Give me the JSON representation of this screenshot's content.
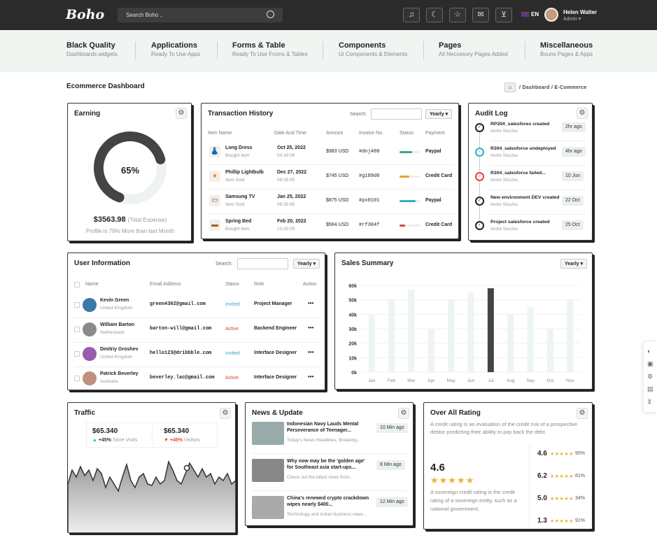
{
  "topbar": {
    "logo": "Boho",
    "search_placeholder": "Search Boho ..",
    "lang": "EN",
    "user_name": "Helen Walter",
    "user_role": "Admin"
  },
  "mega": [
    {
      "title": "Black Quality",
      "sub": "Dashboards,widgets."
    },
    {
      "title": "Applications",
      "sub": "Ready To Use Apps"
    },
    {
      "title": "Forms & Table",
      "sub": "Ready To Use Froms & Tables"
    },
    {
      "title": "Components",
      "sub": "Ui Components & Elements"
    },
    {
      "title": "Pages",
      "sub": "All Neccesory Pages Added"
    },
    {
      "title": "Miscellaneous",
      "sub": "Bouns Pages & Apps"
    }
  ],
  "page": {
    "title": "Ecommerce Dashboard",
    "crumb1": "Dashboard",
    "crumb2": "E-Commerce"
  },
  "earning": {
    "title": "Earning",
    "percent": "65%",
    "percent_value": 65,
    "amount": "$3563.98",
    "amount_note": "(Total Expense)",
    "profile": "Profile is 76% More than last Month"
  },
  "transactions": {
    "title": "Transaction History",
    "search_label": "Search:",
    "filter": "Yearly",
    "headers": [
      "Item Name",
      "Date And Time",
      "Amount",
      "Invoice No.",
      "Status",
      "Payment"
    ],
    "rows": [
      {
        "name": "Long Dress",
        "sub": "Bought item",
        "date": "Oct 25, 2022",
        "time": "04:39:08",
        "amount": "$983 USD",
        "invoice": "#dnj480",
        "status_fill": 0.6,
        "status_color": "#3aa87a",
        "payment": "Paypal"
      },
      {
        "name": "Phillip Lightbulb",
        "sub": "Item Sold",
        "date": "Dec 27, 2022",
        "time": "08:35:65",
        "amount": "$745 USD",
        "invoice": "#g189d0",
        "status_fill": 0.45,
        "status_color": "#f0a030",
        "payment": "Credit Card"
      },
      {
        "name": "Samsung TV",
        "sub": "Item Sold",
        "date": "Jan 25, 2022",
        "time": "08:35:65",
        "amount": "$875 USD",
        "invoice": "#px0101",
        "status_fill": 0.75,
        "status_color": "#2bb3c0",
        "payment": "Paypal"
      },
      {
        "name": "Spring Bed",
        "sub": "Bought item",
        "date": "Feb 20, 2022",
        "time": "12:35:00",
        "amount": "$564 USD",
        "invoice": "#rf304f",
        "status_fill": 0.25,
        "status_color": "#e04040",
        "payment": "Credit Card"
      }
    ]
  },
  "audit": {
    "title": "Audit Log",
    "items": [
      {
        "title": "RP204_salesfores created",
        "by": "Andre Sluczka",
        "when": "2hr ago",
        "color": "#222"
      },
      {
        "title": "R304_salesforce undeployed",
        "by": "Andre Sluczka",
        "when": "4hr ago",
        "color": "#2bb3c0"
      },
      {
        "title": "R304_salesforce failed...",
        "by": "Andre Sluczka",
        "when": "10 Jun",
        "color": "#e04040"
      },
      {
        "title": "New environment DEV created",
        "by": "Andre Sluczka",
        "when": "22 Oct",
        "color": "#222"
      },
      {
        "title": "Project salesforce created",
        "by": "Andre Sluczka",
        "when": "25 Oct",
        "color": "#222"
      }
    ]
  },
  "users": {
    "title": "User Information",
    "search_label": "Search:",
    "filter": "Yearly",
    "headers": [
      "Name",
      "Email Address",
      "Status",
      "Role",
      "Action"
    ],
    "rows": [
      {
        "name": "Kevin Green",
        "country": "United Kingdom",
        "email": "green4302@gmail.com",
        "status": "Invited",
        "status_color": "#3aa8c0",
        "role": "Project Manager",
        "action": "•••",
        "avatar": "#3a7aa8"
      },
      {
        "name": "William Barton",
        "country": "Netherlands",
        "email": "barton-will@gmail.com",
        "status": "Active",
        "status_color": "#e04040",
        "role": "Backend Engineer",
        "action": "•••",
        "avatar": "#8a8a8a"
      },
      {
        "name": "Dmitriy Groshev",
        "country": "United Kingdom",
        "email": "hello123@dribbble.com",
        "status": "Invited",
        "status_color": "#3aa8c0",
        "role": "Interface Designer",
        "action": "•••",
        "avatar": "#9a5ab0"
      },
      {
        "name": "Patrick Beverley",
        "country": "Australia",
        "email": "beverley.lac@gmail.com",
        "status": "Active",
        "status_color": "#e04040",
        "role": "Interface Designer",
        "action": "•••",
        "avatar": "#c09080"
      }
    ]
  },
  "sales": {
    "title": "Sales Summary",
    "filter": "Yearly"
  },
  "chart_data": {
    "type": "bar",
    "categories": [
      "Jan",
      "Feb",
      "Mar",
      "Apr",
      "May",
      "Jun",
      "Jul",
      "Aug",
      "Sep",
      "Oct",
      "Nov"
    ],
    "values": [
      40,
      50,
      57,
      30,
      50,
      55,
      58,
      40,
      45,
      30,
      50
    ],
    "yticks": [
      "0k",
      "10k",
      "20k",
      "30k",
      "40k",
      "50k",
      "60k"
    ],
    "ylim": [
      0,
      60
    ],
    "highlight": "Jul",
    "colors": {
      "bar": "#eef5ef",
      "highlight": "#444"
    }
  },
  "traffic": {
    "title": "Traffic",
    "v1": "$65.340",
    "c1": "+45%",
    "l1": "Store Visits",
    "v2": "$65.340",
    "c2": "+45%",
    "l2": "Visitors"
  },
  "news": {
    "title": "News & Update",
    "items": [
      {
        "title": "Indonesian Navy Lauds Mental Perseverance of Teenager...",
        "sub": "Today's News Headlines, Breaking...",
        "when": "10 Min ago"
      },
      {
        "title": "Why now may be the 'golden age' for Southeast asia start-ups...",
        "sub": "Check out the latest news from...",
        "when": "8 Min ago"
      },
      {
        "title": "China's renewed crypto crackdown wipes nearly $400...",
        "sub": "Technology and indian business news...",
        "when": "12 Min ago"
      }
    ]
  },
  "rating": {
    "title": "Over All Rating",
    "desc": "A credit rating is an evaluation of the credit risk of a prospective debtor predicting their ability to pay back the debt.",
    "score": "4.6",
    "stars": 5,
    "desc2": "A sovereign credit rating is the credit rating of a sovereign entity, such as a national government.",
    "rows": [
      {
        "v": "4.6",
        "p": "95%"
      },
      {
        "v": "6.2",
        "p": "61%"
      },
      {
        "v": "5.0",
        "p": "34%"
      },
      {
        "v": "1.3",
        "p": "91%"
      }
    ]
  }
}
